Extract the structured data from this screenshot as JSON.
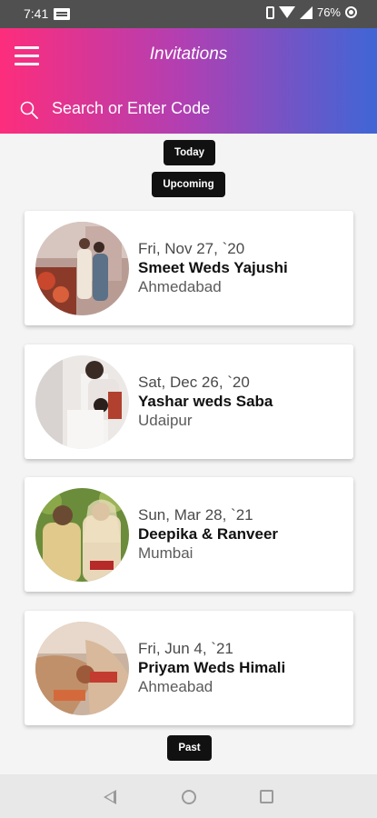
{
  "status_bar": {
    "time": "7:41",
    "battery": "76%"
  },
  "header": {
    "title": "Invitations",
    "search_placeholder": "Search or Enter Code"
  },
  "sections": {
    "today": "Today",
    "upcoming": "Upcoming",
    "past": "Past"
  },
  "invitations": [
    {
      "date": "Fri, Nov 27, `20",
      "name": "Smeet Weds Yajushi",
      "city": "Ahmedabad"
    },
    {
      "date": "Sat, Dec 26, `20",
      "name": "Yashar weds Saba",
      "city": "Udaipur"
    },
    {
      "date": "Sun, Mar 28, `21",
      "name": "Deepika & Ranveer",
      "city": "Mumbai"
    },
    {
      "date": "Fri, Jun 4, `21",
      "name": "Priyam Weds Himali",
      "city": "Ahmeabad"
    }
  ],
  "colors": {
    "header_start": "#fd2d7c",
    "header_mid": "#b23fb2",
    "header_end": "#3f66d6",
    "pill_bg": "#111111"
  },
  "nav_icons": [
    "back-icon",
    "home-icon",
    "recents-icon"
  ]
}
